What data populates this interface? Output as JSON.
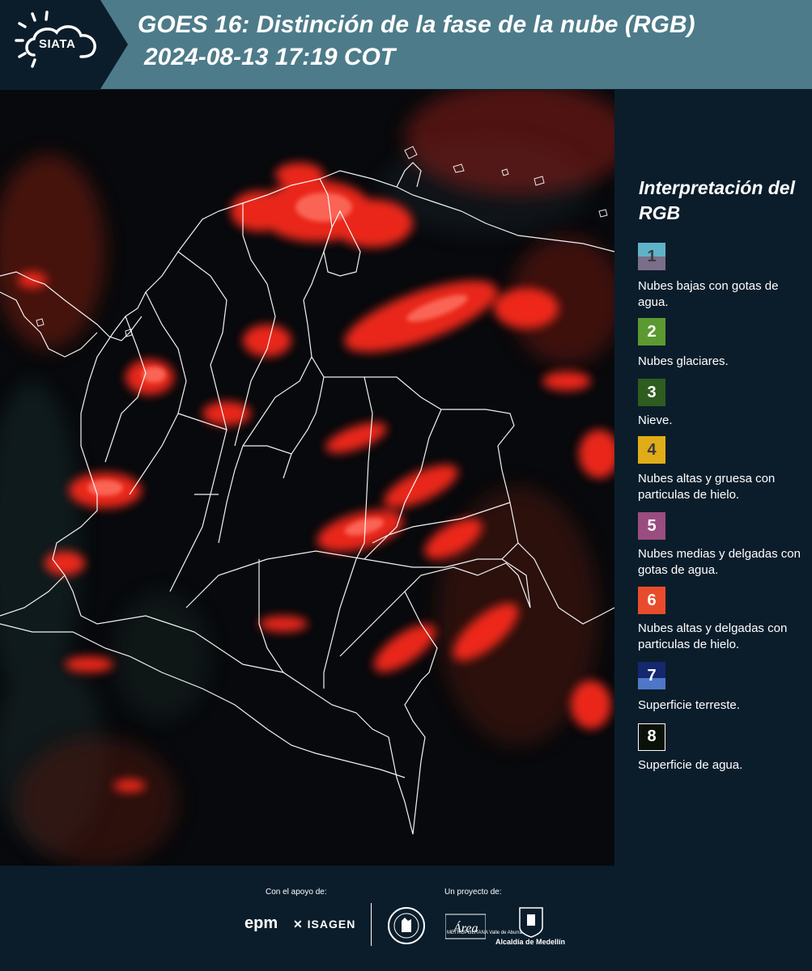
{
  "header": {
    "logo_text": "SIATA",
    "title_line1": "GOES 16: Distinción de la fase de la nube (RGB)",
    "title_line2": "2024-08-13 17:19 COT",
    "background_color": "#4d7b8a"
  },
  "legend": {
    "title": "Interpretación del RGB",
    "items": [
      {
        "number": "1",
        "label": "Nubes bajas con gotas de agua.",
        "color_top": "#5fb3c8",
        "color_bottom": "#7a6e8a",
        "number_color": "#3c3c3c"
      },
      {
        "number": "2",
        "label": "Nubes glaciares.",
        "color_top": "#5c9a31",
        "color_bottom": "#5c9a31",
        "number_color": "#ffffff"
      },
      {
        "number": "3",
        "label": "Nieve.",
        "color_top": "#2f5c1f",
        "color_bottom": "#2f5c1f",
        "number_color": "#ffffff"
      },
      {
        "number": "4",
        "label": "Nubes altas y gruesa con particulas de hielo.",
        "color_top": "#e0ad19",
        "color_bottom": "#e0ad19",
        "number_color": "#3c3c3c"
      },
      {
        "number": "5",
        "label": "Nubes medias y delgadas con gotas de agua.",
        "color_top": "#9a4d80",
        "color_bottom": "#9a4d80",
        "number_color": "#ffffff"
      },
      {
        "number": "6",
        "label": "Nubes altas y delgadas con particulas de hielo.",
        "color_top": "#e84c2c",
        "color_bottom": "#e84c2c",
        "number_color": "#ffffff"
      },
      {
        "number": "7",
        "label": "Superficie terreste.",
        "color_top": "#14286e",
        "color_bottom": "#4f77c8",
        "number_color": "#ffffff"
      },
      {
        "number": "8",
        "label": "Superficie de agua.",
        "color_top": "#0a1208",
        "color_bottom": "#0a1208",
        "number_color": "#ffffff"
      }
    ]
  },
  "footer": {
    "support_label": "Con el apoyo de:",
    "project_label": "Un proyecto de:",
    "epm_logo": "epm",
    "isagen_logo": "ISAGEN",
    "area_logo": "Área",
    "area_text": "METROPOLITANA Valle de Aburrá",
    "alcaldia_label": "Alcaldía de Medellín"
  }
}
